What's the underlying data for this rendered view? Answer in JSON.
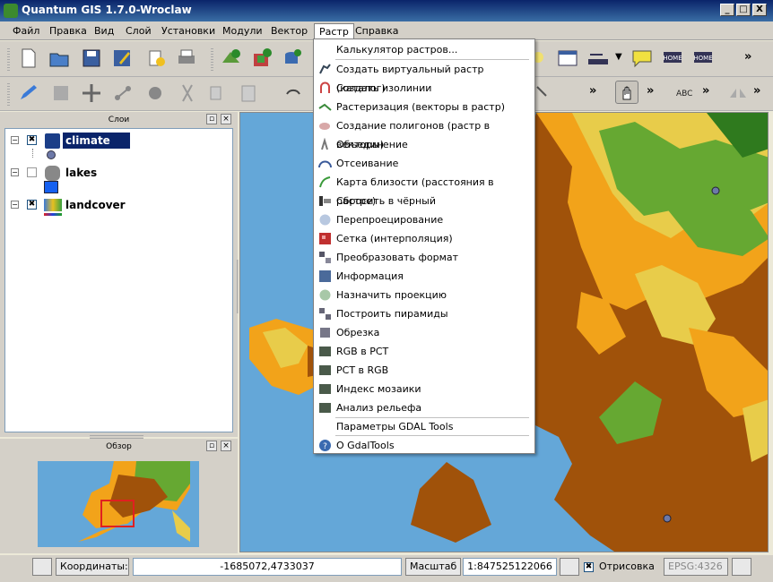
{
  "window": {
    "title": "Quantum GIS 1.7.0-Wroclaw",
    "min": "_",
    "max": "□",
    "close": "X"
  },
  "menubar": [
    "Файл",
    "Правка",
    "Вид",
    "Слой",
    "Установки",
    "Модули",
    "Вектор",
    "Растр",
    "Справка"
  ],
  "raster_menu": [
    {
      "label": "Калькулятор растров...",
      "icon": "none"
    },
    {
      "label": "Создать виртуальный растр (каталог)",
      "icon": "virtual-raster-icon"
    },
    {
      "label": "Создать изолинии",
      "icon": "contour-icon"
    },
    {
      "label": "Растеризация (векторы в растр)",
      "icon": "rasterize-icon"
    },
    {
      "label": "Создание полигонов (растр в векторы)",
      "icon": "polygonize-icon"
    },
    {
      "label": "Объединение",
      "icon": "merge-icon"
    },
    {
      "label": "Отсеивание",
      "icon": "sieve-icon"
    },
    {
      "label": "Карта близости (расстояния в растре)",
      "icon": "proximity-icon"
    },
    {
      "label": "Сбросить в чёрный",
      "icon": "nearblack-icon"
    },
    {
      "label": "Перепроецирование",
      "icon": "warp-icon"
    },
    {
      "label": "Сетка (интерполяция)",
      "icon": "grid-icon"
    },
    {
      "label": "Преобразовать формат",
      "icon": "translate-icon"
    },
    {
      "label": "Информация",
      "icon": "info-icon"
    },
    {
      "label": "Назначить проекцию",
      "icon": "projection-icon"
    },
    {
      "label": "Построить пирамиды",
      "icon": "pyramids-icon"
    },
    {
      "label": "Обрезка",
      "icon": "clip-icon"
    },
    {
      "label": "RGB в PCT",
      "icon": "rgb2pct-icon"
    },
    {
      "label": "PCT в RGB",
      "icon": "pct2rgb-icon"
    },
    {
      "label": "Индекс мозаики",
      "icon": "tileindex-icon"
    },
    {
      "label": "Анализ рельефа",
      "icon": "dem-icon"
    },
    {
      "label": "Параметры GDAL Tools",
      "icon": "none"
    },
    {
      "label": "О GdalTools",
      "icon": "about-icon"
    }
  ],
  "layers_panel": {
    "title": "Слои"
  },
  "layers": [
    {
      "name": "climate",
      "checked": "✖",
      "expander": "−"
    },
    {
      "name": "lakes",
      "checked": "",
      "expander": "−"
    },
    {
      "name": "landcover",
      "checked": "✖",
      "expander": "−"
    }
  ],
  "overview_panel": {
    "title": "Обзор"
  },
  "toolbar_more": "»",
  "statusbar": {
    "coords_label": "Координаты:",
    "coords_value": "-1685072,4733037",
    "scale_label": "Масштаб",
    "scale_value": "1:847525122066",
    "render_label": "Отрисовка",
    "render_checked": "✖",
    "crs": "EPSG:4326"
  },
  "colors": {
    "water": "#64a7d8",
    "brown": "#a0520a",
    "orange": "#f2a31a",
    "yellow": "#e8cc4a",
    "green": "#66a832",
    "darkgreen": "#2f7a1e",
    "selection": "#0a246a"
  }
}
